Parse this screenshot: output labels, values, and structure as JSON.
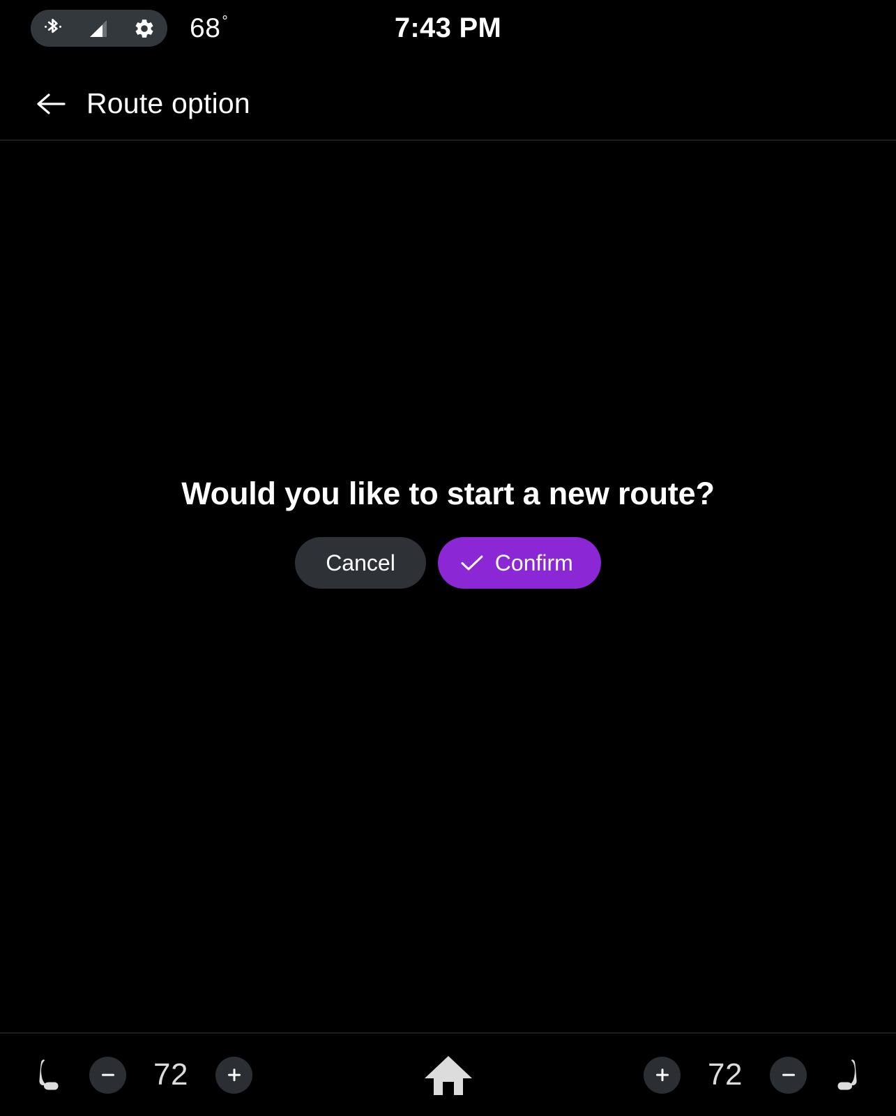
{
  "status_bar": {
    "bluetooth_icon": "bluetooth-icon",
    "signal_icon": "signal-strength-icon",
    "settings_icon": "gear-icon",
    "temperature": "68",
    "degree_symbol": "°",
    "clock": "7:43 PM"
  },
  "header": {
    "back_icon": "back-arrow-icon",
    "title": "Route option"
  },
  "dialog": {
    "message": "Would you like to start a new route?",
    "cancel_label": "Cancel",
    "confirm_label": "Confirm",
    "confirm_icon": "check-icon"
  },
  "bottom_bar": {
    "left": {
      "seat_icon": "seat-heater-left-icon",
      "decrease_label": "−",
      "temperature": "72",
      "increase_label": "+"
    },
    "home_icon": "home-icon",
    "right": {
      "increase_label": "+",
      "temperature": "72",
      "decrease_label": "−",
      "seat_icon": "seat-heater-right-icon"
    }
  },
  "colors": {
    "background": "#000000",
    "accent_purple": "#8b27d4",
    "surface_gray": "#2e3236",
    "pill_gray": "#33383c",
    "icon_light": "#dcdcdc",
    "divider": "#1e1e1e"
  }
}
